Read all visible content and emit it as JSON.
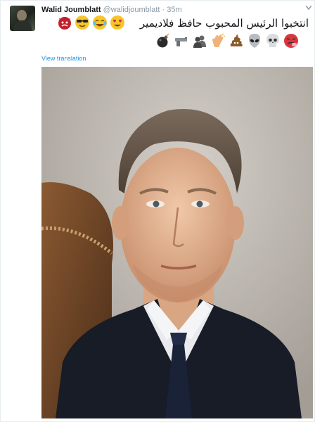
{
  "tweet": {
    "author_name": "Walid Joumblatt",
    "author_handle": "@walidjoumblatt",
    "separator": "·",
    "time_ago": "35m",
    "text": "انتخبوا الرئيس المحبوب حافظ فلاديمير",
    "translate_label": "View translation",
    "emoji_row1": [
      "angry-devil-icon",
      "sunglasses-icon",
      "tears-of-joy-icon",
      "heart-eyes-icon"
    ],
    "emoji_row2": [
      "bomb-icon",
      "gun-icon",
      "silhouettes-icon",
      "clap-icon",
      "poop-icon",
      "alien-icon",
      "skull-icon",
      "nauseated-icon"
    ]
  },
  "colors": {
    "link": "#1b95e0",
    "muted": "#8899a6",
    "text": "#14171a"
  }
}
